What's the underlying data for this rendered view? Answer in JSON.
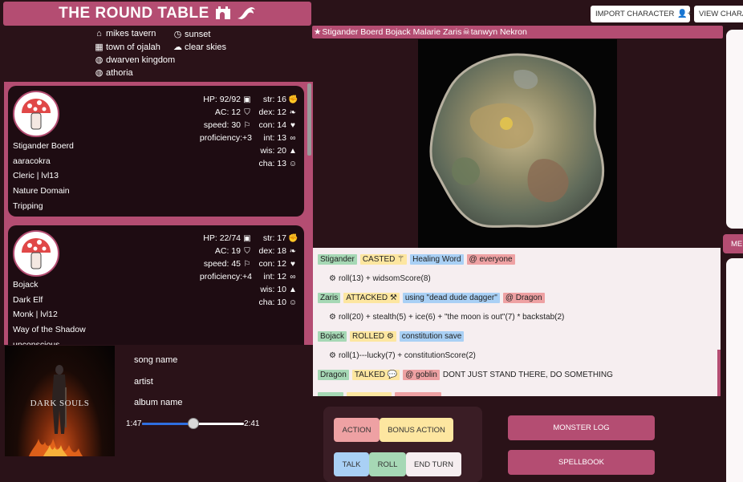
{
  "header": {
    "title": "THE ROUND TABLE",
    "buttons": {
      "import_character": "IMPORT CHARACTER",
      "view_characters": "VIEW CHARA"
    }
  },
  "location": {
    "tavern": "mikes tavern",
    "town": "town of ojalah",
    "kingdom": "dwarven kingdom",
    "world": "athoria",
    "time": "sunset",
    "weather": "clear skies"
  },
  "party_banner": {
    "members": "Stigander Boerd Bojack Malarie Zaris",
    "dead": "tanwyn Nekron"
  },
  "characters": [
    {
      "name": "Stigander Boerd",
      "race": "aaracokra",
      "class_level": "Cleric | lvl13",
      "subclass": "Nature Domain",
      "status": "Tripping",
      "hp": "HP: 92/92",
      "ac": "AC: 12",
      "speed": "speed: 30",
      "proficiency": "proficiency:+3",
      "str": "str: 16",
      "dex": "dex: 12",
      "con": "con: 14",
      "int": "int: 13",
      "wis": "wis: 20",
      "cha": "cha: 13"
    },
    {
      "name": "Bojack",
      "race": "Dark Elf",
      "class_level": "Monk | lvl12",
      "subclass": "Way of the Shadow",
      "status": "unconscious",
      "hp": "HP: 22/74",
      "ac": "AC: 19",
      "speed": "speed: 45",
      "proficiency": "proficiency:+4",
      "str": "str: 17",
      "dex": "dex: 18",
      "con": "con: 12",
      "int": "int: 12",
      "wis": "wis: 10",
      "cha": "cha: 10"
    }
  ],
  "music": {
    "album_art_text": "DARK SOULS",
    "song": "song name",
    "artist": "artist",
    "album": "album name",
    "time_current": "1:47",
    "time_total": "2:41",
    "progress": 0.5
  },
  "log": [
    {
      "actor": "Stigander",
      "verb": "CASTED",
      "verb_icon": "magic-wand-icon",
      "target": "Healing Word",
      "at": "@ everyone",
      "extra": "",
      "roll": "roll(13) + widsomScore(8)"
    },
    {
      "actor": "Zaris",
      "verb": "ATTACKED",
      "verb_icon": "hammer-icon",
      "target": "using \"dead dude dagger\"",
      "at": "@ Dragon",
      "extra": "",
      "roll": "roll(20) + stealth(5) + ice(6) + \"the moon is out\"(7) * backstab(2)"
    },
    {
      "actor": "Bojack",
      "verb": "ROLLED",
      "verb_icon": "d20-icon",
      "target": "constitution save",
      "at": "",
      "extra": "",
      "roll": "roll(1)---lucky(7) + constitutionScore(2)"
    },
    {
      "actor": "Dragon",
      "verb": "TALKED",
      "verb_icon": "speech-icon",
      "target": "",
      "at": "@ goblin",
      "extra": "DONT JUST STAND THERE, DO SOMETHING",
      "roll": ""
    }
  ],
  "actions": {
    "action": "ACTION",
    "bonus_action": "BONUS ACTION",
    "talk": "TALK",
    "roll": "ROLL",
    "end_turn": "END TURN",
    "monster_log": "MONSTER LOG",
    "spellbook": "SPELLBOOK"
  },
  "right_tab": "ME",
  "colors": {
    "accent": "#b44d72",
    "background": "#2a1218",
    "card": "#1e0c12",
    "log_bg": "#f6eef0",
    "tag_green": "#a6d8b5",
    "tag_yellow": "#fde6a0",
    "tag_blue": "#a9d0f5",
    "tag_red": "#eea1a3"
  }
}
